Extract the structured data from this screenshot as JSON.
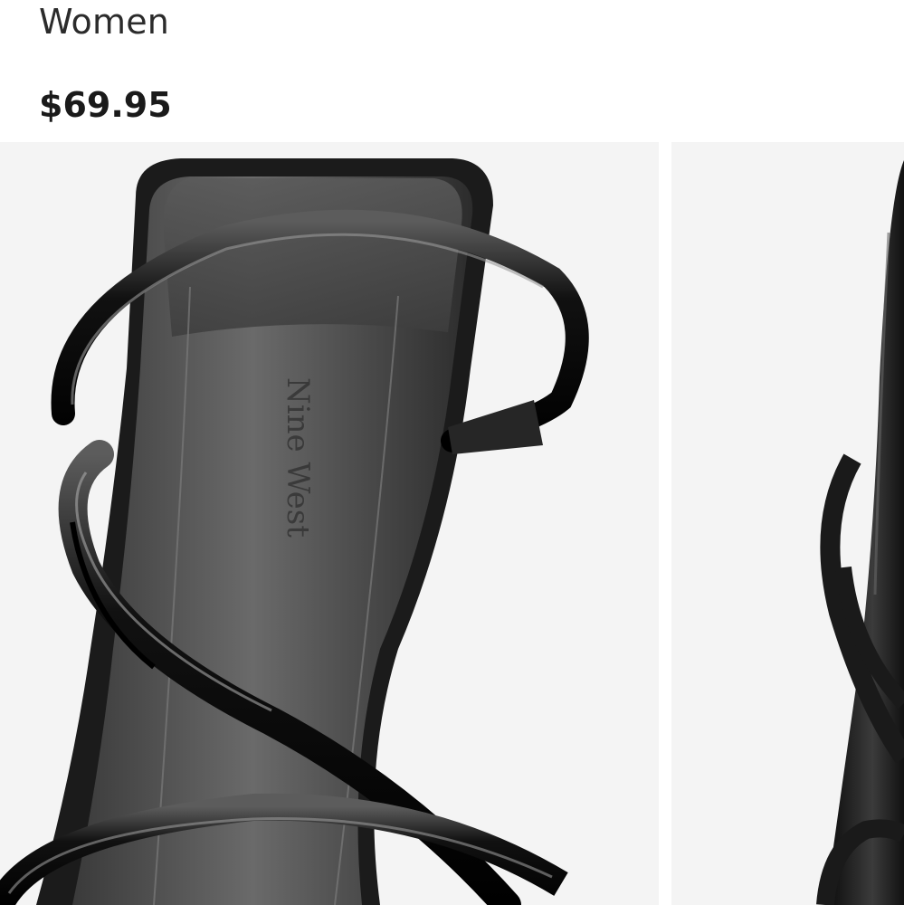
{
  "product": {
    "category": "Women",
    "price": "$69.95"
  },
  "gallery": {
    "images": [
      {
        "alt": "Black patent strappy heeled sandal close-up",
        "brand_mark": "Nine West"
      },
      {
        "alt": "Black patent strappy heeled sandal side view"
      }
    ]
  }
}
